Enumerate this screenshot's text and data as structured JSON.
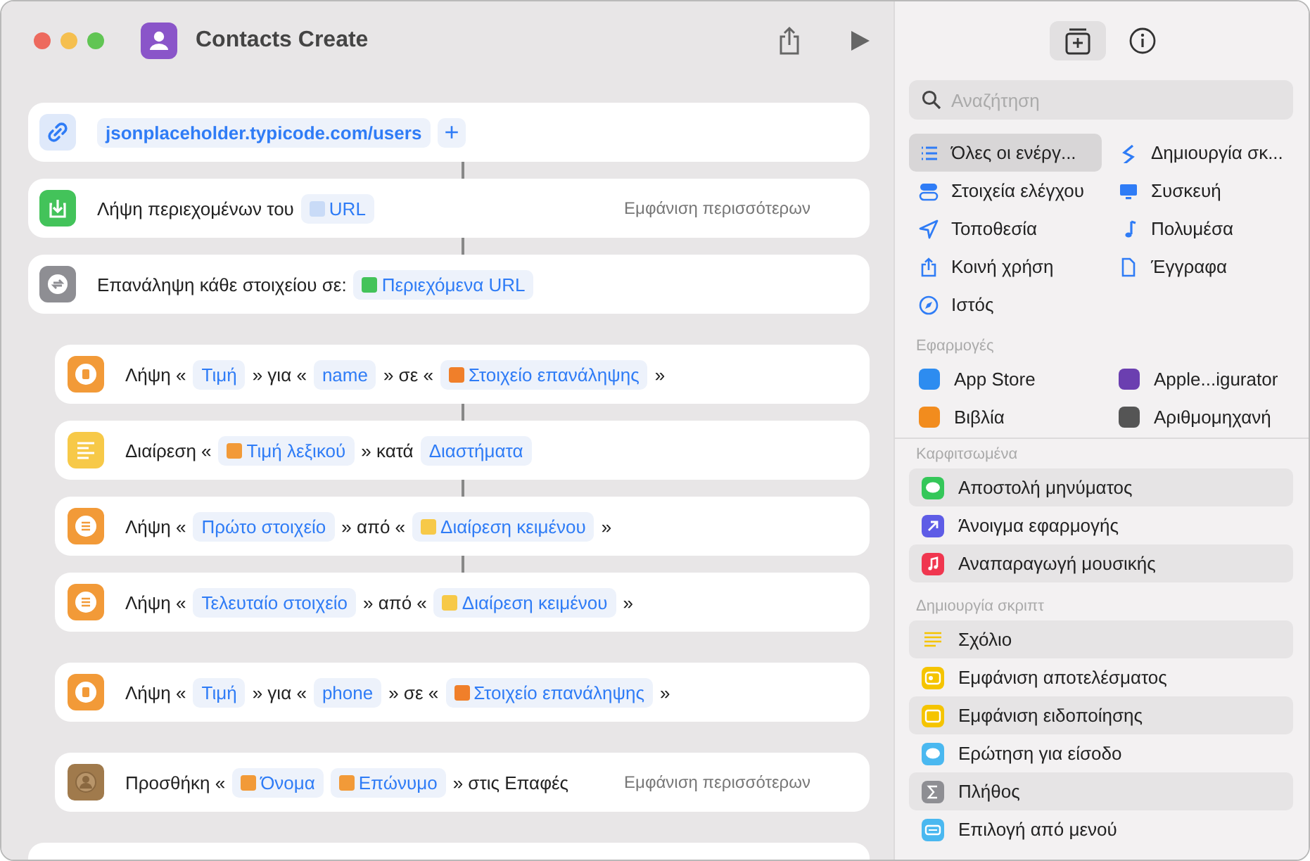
{
  "window": {
    "title": "Contacts Create"
  },
  "actions": [
    {
      "kind": "link",
      "linked": false,
      "indent": false,
      "parts": [
        {
          "kind": "url",
          "text": "jsonplaceholder.typicode.com/users"
        },
        {
          "kind": "add",
          "text": "+"
        }
      ]
    },
    {
      "kind": "download",
      "linked": true,
      "indent": false,
      "parts": [
        {
          "kind": "text",
          "text": "Λήψη περιεχομένων του"
        },
        {
          "kind": "token",
          "text": "URL",
          "color": "#c9dbf7"
        }
      ],
      "more": "Εμφάνιση περισσότερων"
    },
    {
      "kind": "repeat",
      "linked": true,
      "indent": false,
      "parts": [
        {
          "kind": "text",
          "text": "Επανάληψη κάθε στοιχείου σε:"
        },
        {
          "kind": "token",
          "text": "Περιεχόμενα URL",
          "color": "#43c35a"
        }
      ]
    },
    {
      "kind": "dictionary",
      "linked": false,
      "indent": true,
      "parts": [
        {
          "kind": "text",
          "text": "Λήψη «"
        },
        {
          "kind": "token",
          "text": "Τιμή"
        },
        {
          "kind": "text",
          "text": "» για «"
        },
        {
          "kind": "token",
          "text": "name"
        },
        {
          "kind": "text",
          "text": "» σε «"
        },
        {
          "kind": "token",
          "text": "Στοιχείο επανάληψης",
          "color": "#f07f2a"
        },
        {
          "kind": "text",
          "text": "»"
        }
      ]
    },
    {
      "kind": "text",
      "linked": true,
      "indent": true,
      "parts": [
        {
          "kind": "text",
          "text": "Διαίρεση «"
        },
        {
          "kind": "token",
          "text": "Τιμή λεξικού",
          "color": "#f29a38"
        },
        {
          "kind": "text",
          "text": "» κατά"
        },
        {
          "kind": "token",
          "text": "Διαστήματα"
        }
      ]
    },
    {
      "kind": "list",
      "linked": true,
      "indent": true,
      "parts": [
        {
          "kind": "text",
          "text": "Λήψη «"
        },
        {
          "kind": "token",
          "text": "Πρώτο στοιχείο"
        },
        {
          "kind": "text",
          "text": "» από «"
        },
        {
          "kind": "token",
          "text": "Διαίρεση κειμένου",
          "color": "#f7c948"
        },
        {
          "kind": "text",
          "text": "»"
        }
      ]
    },
    {
      "kind": "list",
      "linked": true,
      "indent": true,
      "parts": [
        {
          "kind": "text",
          "text": "Λήψη «"
        },
        {
          "kind": "token",
          "text": "Τελευταίο στοιχείο"
        },
        {
          "kind": "text",
          "text": "» από «"
        },
        {
          "kind": "token",
          "text": "Διαίρεση κειμένου",
          "color": "#f7c948"
        },
        {
          "kind": "text",
          "text": "»"
        }
      ]
    },
    {
      "kind": "dictionary",
      "linked": false,
      "indent": true,
      "parts": [
        {
          "kind": "text",
          "text": "Λήψη «"
        },
        {
          "kind": "token",
          "text": "Τιμή"
        },
        {
          "kind": "text",
          "text": "» για «"
        },
        {
          "kind": "token",
          "text": "phone"
        },
        {
          "kind": "text",
          "text": "» σε «"
        },
        {
          "kind": "token",
          "text": "Στοιχείο επανάληψης",
          "color": "#f07f2a"
        },
        {
          "kind": "text",
          "text": "»"
        }
      ]
    },
    {
      "kind": "contacts",
      "linked": false,
      "indent": true,
      "parts": [
        {
          "kind": "text",
          "text": "Προσθήκη «"
        },
        {
          "kind": "token",
          "text": "Όνομα",
          "color": "#f29a38"
        },
        {
          "kind": "token",
          "text": "Επώνυμο",
          "color": "#f29a38"
        },
        {
          "kind": "text",
          "text": "» στις Επαφές"
        }
      ],
      "more": "Εμφάνιση περισσότερων"
    }
  ],
  "sidebar": {
    "tabs": [
      {
        "kind": "library",
        "selected": true
      },
      {
        "kind": "info",
        "selected": false
      }
    ],
    "search": {
      "placeholder": "Αναζήτηση"
    },
    "categories": [
      {
        "label": "Όλες οι ενέργ...",
        "kind": "list",
        "selected": true
      },
      {
        "label": "Δημιουργία σκ...",
        "kind": "scripting",
        "selected": false
      },
      {
        "label": "Στοιχεία ελέγχου",
        "kind": "toggles",
        "selected": false
      },
      {
        "label": "Συσκευή",
        "kind": "monitor",
        "selected": false
      },
      {
        "label": "Τοποθεσία",
        "kind": "location",
        "selected": false
      },
      {
        "label": "Πολυμέσα",
        "kind": "note",
        "selected": false
      },
      {
        "label": "Κοινή χρήση",
        "kind": "share",
        "selected": false
      },
      {
        "label": "Έγγραφα",
        "kind": "document",
        "selected": false
      },
      {
        "label": "Ιστός",
        "kind": "compass",
        "selected": false
      }
    ],
    "apps_title": "Εφαρμογές",
    "apps": [
      {
        "label": "App Store",
        "color": "#2d8cf0"
      },
      {
        "label": "Apple...igurator",
        "color": "#6b3fb0"
      },
      {
        "label": "Βιβλία",
        "color": "#f28c1e"
      },
      {
        "label": "Αριθμομηχανή",
        "color": "#555555"
      }
    ],
    "pinned_title": "Καρφιτσωμένα",
    "pinned": [
      {
        "label": "Αποστολή μηνύματος",
        "kind": "bubble",
        "color": "#34c759"
      },
      {
        "label": "Άνοιγμα εφαρμογής",
        "kind": "arrow",
        "color": "#5e5ce6"
      },
      {
        "label": "Αναπαραγωγή μουσικής",
        "kind": "note",
        "color": "#f0364f"
      }
    ],
    "scripting_title": "Δημιουργία σκριπτ",
    "scripting": [
      {
        "label": "Σχόλιο",
        "kind": "lines",
        "color": "#f5c400"
      },
      {
        "label": "Εμφάνιση αποτελέσματος",
        "kind": "result",
        "color": "#f5c400"
      },
      {
        "label": "Εμφάνιση ειδοποίησης",
        "kind": "banner",
        "color": "#f5c400"
      },
      {
        "label": "Ερώτηση για είσοδο",
        "kind": "bubble",
        "color": "#4ab8f0"
      },
      {
        "label": "Πλήθος",
        "kind": "sigma",
        "color": "#8e8e93"
      },
      {
        "label": "Επιλογή από μενού",
        "kind": "menu",
        "color": "#4ab8f0"
      }
    ]
  }
}
